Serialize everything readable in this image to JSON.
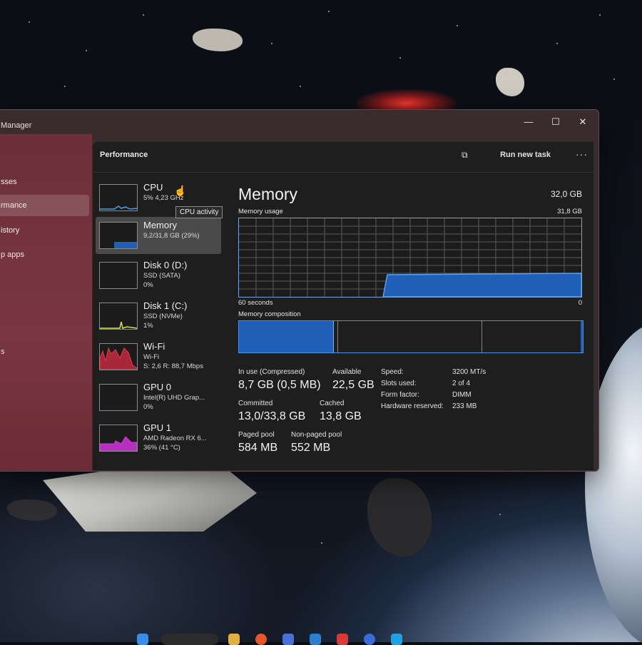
{
  "window": {
    "title": "Manager",
    "minimize": "—",
    "maximize": "☐",
    "close": "✕"
  },
  "sidebar": {
    "items": [
      {
        "label": "sses"
      },
      {
        "label": "rmance"
      },
      {
        "label": "istory"
      },
      {
        "label": "p apps"
      }
    ],
    "extra": [
      {
        "label": "s"
      },
      {
        "label": "s"
      }
    ]
  },
  "header": {
    "title": "Performance",
    "run_task": "Run new task",
    "more": "···"
  },
  "perf_list": [
    {
      "name": "CPU",
      "sub": "5% 4,23 GHz",
      "val": ""
    },
    {
      "name": "Memory",
      "sub": "9,2/31,8 GB (29%)",
      "val": ""
    },
    {
      "name": "Disk 0 (D:)",
      "sub": "SSD (SATA)",
      "val": "0%"
    },
    {
      "name": "Disk 1 (C:)",
      "sub": "SSD (NVMe)",
      "val": "1%"
    },
    {
      "name": "Wi-Fi",
      "sub": "Wi-Fi",
      "val": "S: 2,6 R: 88,7 Mbps"
    },
    {
      "name": "GPU 0",
      "sub": "Intel(R) UHD Grap...",
      "val": "0%"
    },
    {
      "name": "GPU 1",
      "sub": "AMD Radeon RX 6...",
      "val": "36% (41 °C)"
    }
  ],
  "tooltip": "CPU activity",
  "memory": {
    "title": "Memory",
    "total": "32,0 GB",
    "usage_label": "Memory usage",
    "usage_max": "31,8 GB",
    "axis_left": "60 seconds",
    "axis_right": "0",
    "composition_label": "Memory composition",
    "usage_fraction": 0.29,
    "stats": {
      "in_use_label": "In use (Compressed)",
      "in_use_value": "8,7 GB (0,5 MB)",
      "available_label": "Available",
      "available_value": "22,5 GB",
      "committed_label": "Committed",
      "committed_value": "13,0/33,8 GB",
      "cached_label": "Cached",
      "cached_value": "13,8 GB",
      "paged_label": "Paged pool",
      "paged_value": "584 MB",
      "nonpaged_label": "Non-paged pool",
      "nonpaged_value": "552 MB"
    },
    "kv": [
      {
        "key": "Speed:",
        "val": "3200 MT/s"
      },
      {
        "key": "Slots used:",
        "val": "2 of 4"
      },
      {
        "key": "Form factor:",
        "val": "DIMM"
      },
      {
        "key": "Hardware reserved:",
        "val": "233 MB"
      }
    ]
  },
  "colors": {
    "accent": "#4a90e2",
    "memory_fill": "#1f5fb8",
    "sidebar": "#74343e",
    "wifi_graph": "#e23a4a",
    "gpu_graph": "#d23fd6"
  }
}
